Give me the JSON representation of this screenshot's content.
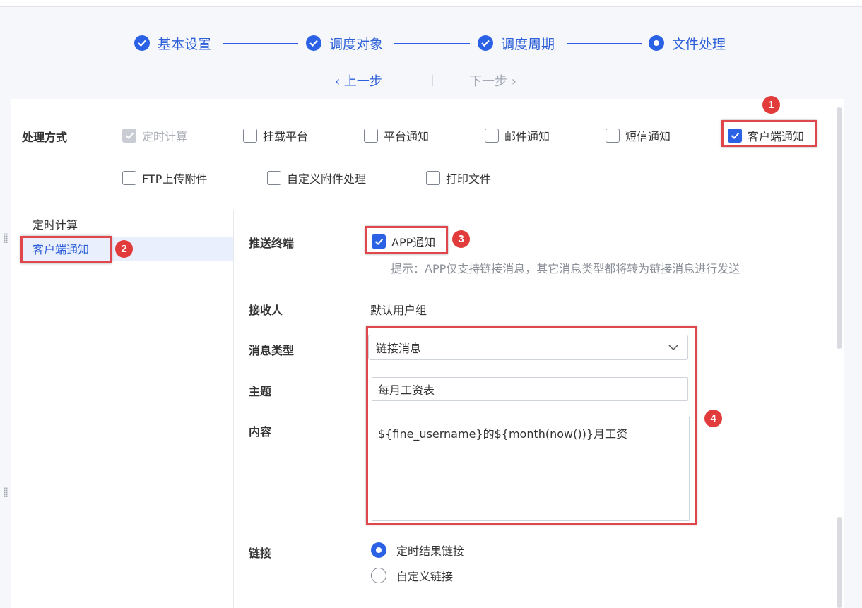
{
  "steps": [
    {
      "label": "基本设置",
      "state": "done"
    },
    {
      "label": "调度对象",
      "state": "done"
    },
    {
      "label": "调度周期",
      "state": "done"
    },
    {
      "label": "文件处理",
      "state": "current"
    }
  ],
  "nav_buttons": {
    "prev": "‹ 上一步",
    "next": "下一步 ›"
  },
  "processing": {
    "label": "处理方式",
    "options": [
      {
        "label": "定时计算",
        "checked": true,
        "disabled": true
      },
      {
        "label": "挂载平台",
        "checked": false
      },
      {
        "label": "平台通知",
        "checked": false
      },
      {
        "label": "邮件通知",
        "checked": false
      },
      {
        "label": "短信通知",
        "checked": false
      },
      {
        "label": "客户端通知",
        "checked": true
      },
      {
        "label": "FTP上传附件",
        "checked": false
      },
      {
        "label": "自定义附件处理",
        "checked": false
      },
      {
        "label": "打印文件",
        "checked": false
      }
    ]
  },
  "sidenav": {
    "items": [
      "定时计算",
      "客户端通知"
    ],
    "active": "客户端通知"
  },
  "form": {
    "push_terminal": {
      "label": "推送终端",
      "option": "APP通知",
      "checked": true,
      "hint": "提示：APP仅支持链接消息，其它消息类型都将转为链接消息进行发送"
    },
    "recipient": {
      "label": "接收人",
      "value": "默认用户组"
    },
    "message_type": {
      "label": "消息类型",
      "value": "链接消息"
    },
    "subject": {
      "label": "主题",
      "value": "每月工资表"
    },
    "content": {
      "label": "内容",
      "value": "${fine_username}的${month(now())}月工资"
    },
    "link": {
      "label": "链接",
      "options": [
        "定时结果链接",
        "自定义链接"
      ],
      "selected": "定时结果链接"
    }
  },
  "annotations": {
    "badges": [
      "1",
      "2",
      "3",
      "4"
    ],
    "color": "#e0474c"
  },
  "colors": {
    "primary": "#2b62e5",
    "annotation": "#e0474c"
  }
}
